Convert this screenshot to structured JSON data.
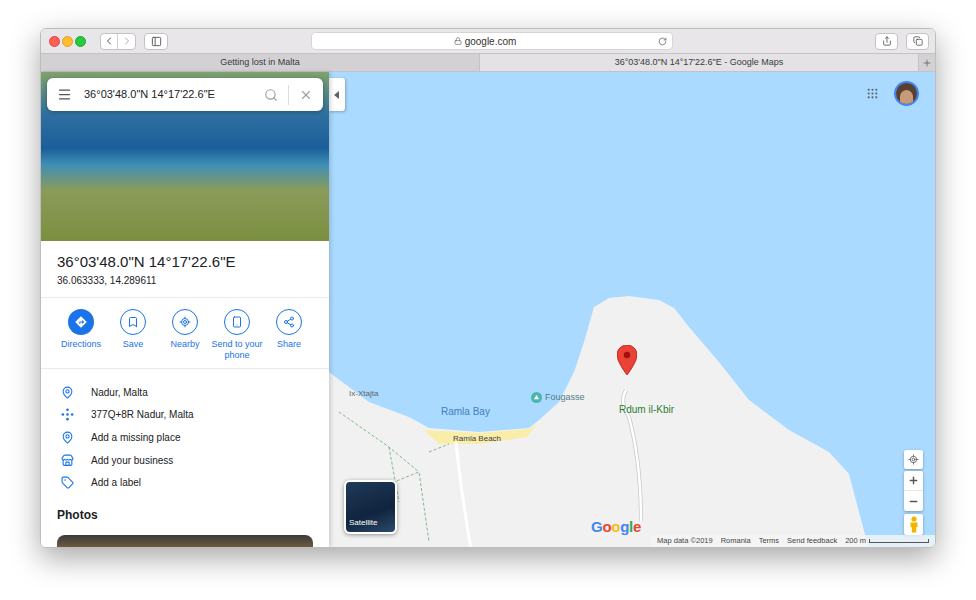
{
  "browser": {
    "address": "google.com",
    "tabs": [
      {
        "label": "Getting lost in Malta",
        "selected": false
      },
      {
        "label": "36°03'48.0\"N 14°17'22.6\"E - Google Maps",
        "selected": true
      }
    ]
  },
  "search": {
    "value": "36°03'48.0\"N 14°17'22.6\"E"
  },
  "place": {
    "title": "36°03'48.0\"N 14°17'22.6\"E",
    "decimal": "36.063333, 14.289611"
  },
  "actions": [
    {
      "label": "Directions",
      "primary": true
    },
    {
      "label": "Save",
      "primary": false
    },
    {
      "label": "Nearby",
      "primary": false
    },
    {
      "label": "Send to your phone",
      "primary": false
    },
    {
      "label": "Share",
      "primary": false
    }
  ],
  "details": [
    {
      "label": "Nadur, Malta",
      "kind": "location"
    },
    {
      "label": "377Q+8R Nadur, Malta",
      "kind": "pluscode"
    },
    {
      "label": "Add a missing place",
      "kind": "addplace"
    },
    {
      "label": "Add your business",
      "kind": "business"
    },
    {
      "label": "Add a label",
      "kind": "label"
    }
  ],
  "photos_heading": "Photos",
  "map": {
    "labels": [
      {
        "text": "Ix-Xtajta",
        "kind": "place"
      },
      {
        "text": "Ramla Bay",
        "kind": "water"
      },
      {
        "text": "Fougasse",
        "kind": "poi"
      },
      {
        "text": "Ramla Beach",
        "kind": "beach"
      },
      {
        "text": "Rdum il-Kbir",
        "kind": "park"
      }
    ],
    "satellite_label": "Satellite",
    "logo": "Google",
    "footer": [
      "Map data ©2019",
      "Romania",
      "Terms",
      "Send feedback"
    ],
    "scale": "200 m"
  }
}
